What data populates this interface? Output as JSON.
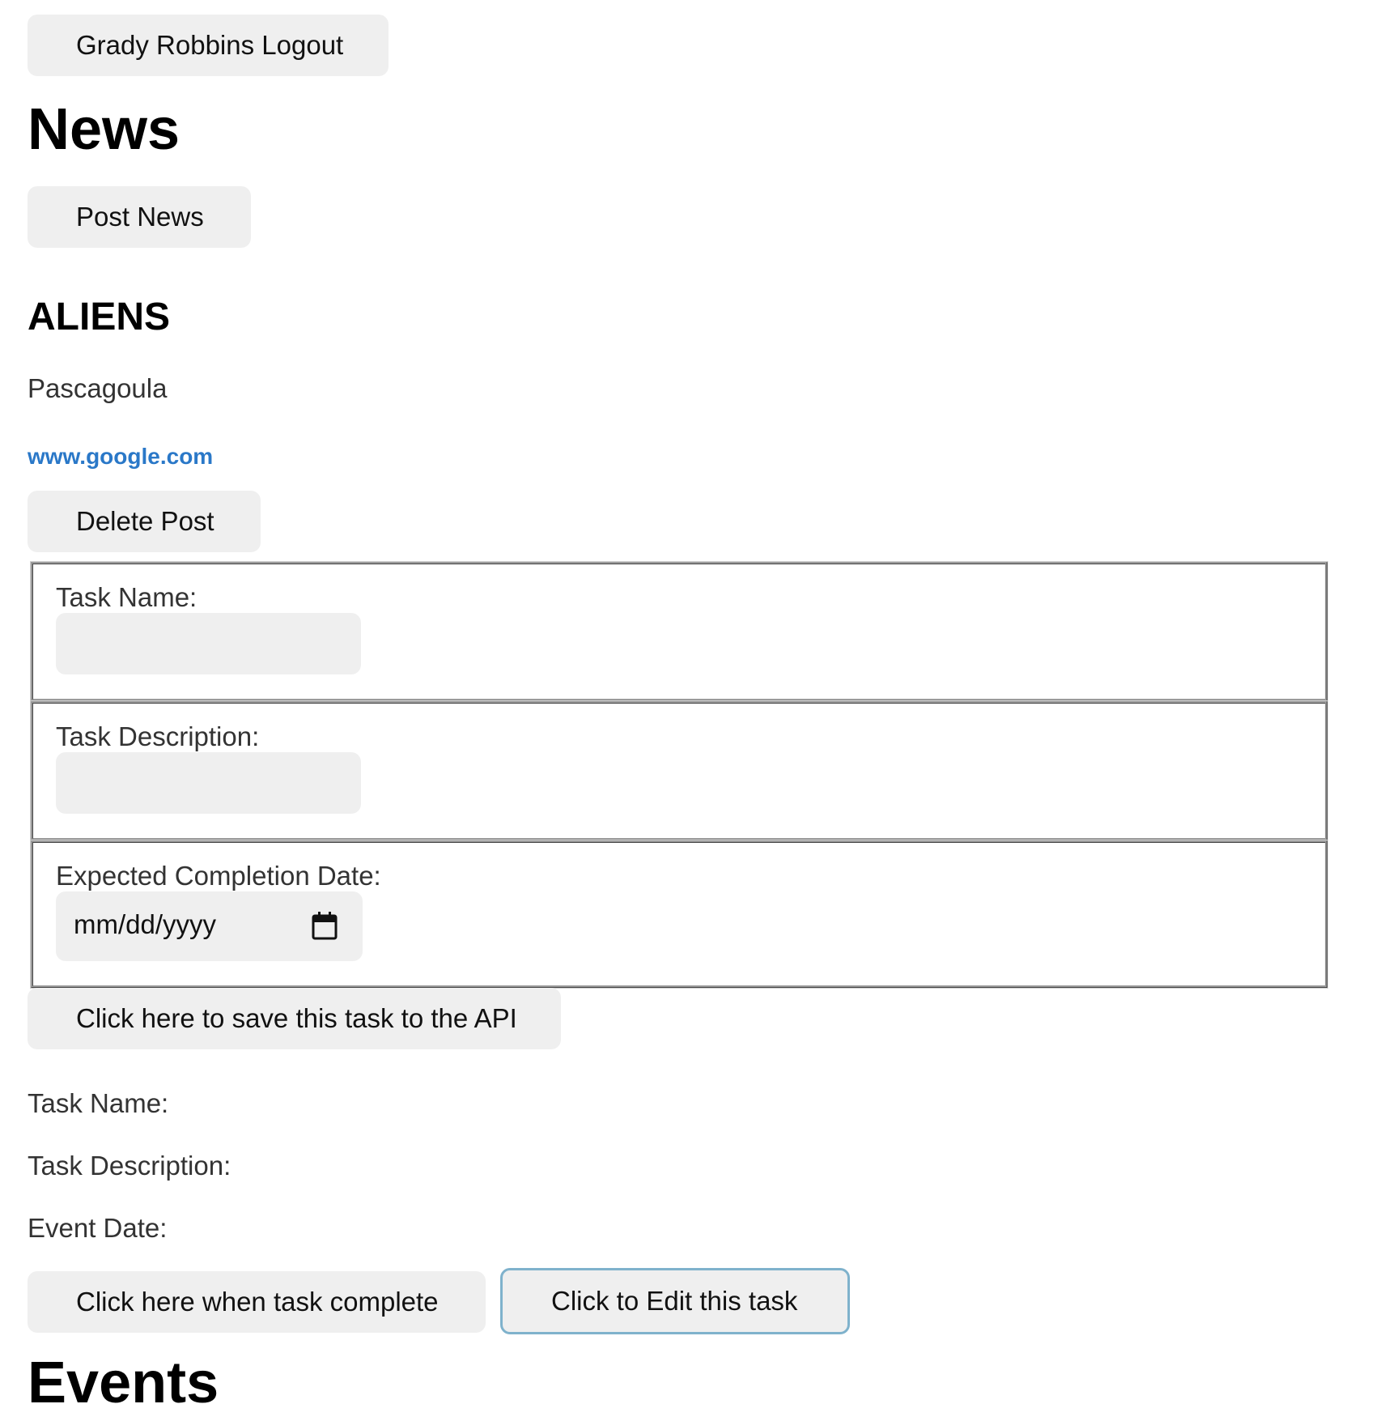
{
  "header": {
    "logout_label": "Grady Robbins Logout"
  },
  "news": {
    "heading": "News",
    "post_button": "Post News",
    "post": {
      "title": "ALIENS",
      "location": "Pascagoula",
      "link": "www.google.com",
      "delete_button": "Delete Post"
    }
  },
  "task_form": {
    "name_label": "Task Name:",
    "name_value": "",
    "description_label": "Task Description:",
    "description_value": "",
    "date_label": "Expected Completion Date:",
    "date_placeholder": "mm/dd/yyyy",
    "save_button": "Click here to save this task to the API"
  },
  "task_display": {
    "name_label": "Task Name:",
    "description_label": "Task Description:",
    "date_label": "Event Date:",
    "complete_button": "Click here when task complete",
    "edit_button": "Click to Edit this task"
  },
  "events": {
    "heading": "Events"
  },
  "icons": {
    "calendar": "calendar-icon"
  },
  "colors": {
    "link": "#2a78c8",
    "button_bg": "#efefef",
    "focus_border": "#7fb2cc"
  }
}
